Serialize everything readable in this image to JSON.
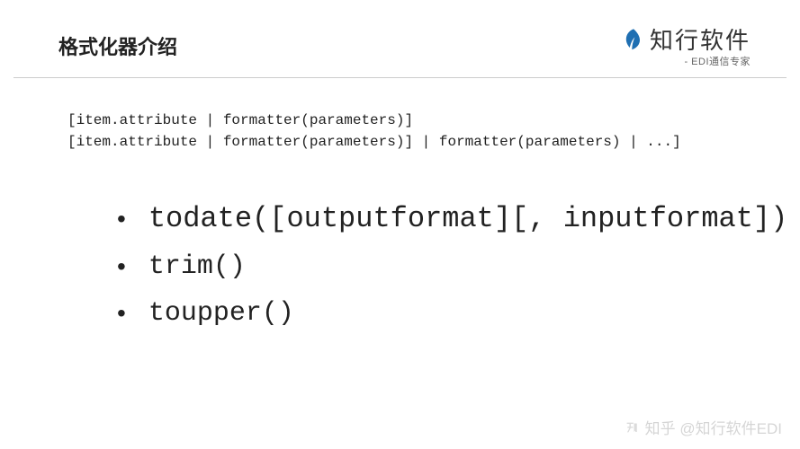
{
  "header": {
    "title": "格式化器介绍",
    "logo_text": "知行软件",
    "logo_subtitle": "- EDI通信专家"
  },
  "code": {
    "line1": "[item.attribute | formatter(parameters)]",
    "line2": "[item.attribute | formatter(parameters)] | formatter(parameters) | ...]"
  },
  "bullets": [
    {
      "text": "todate([outputformat][, inputformat])"
    },
    {
      "text": "trim()"
    },
    {
      "text": "toupper()"
    }
  ],
  "watermark": {
    "brand": "知乎",
    "handle": "@知行软件EDI"
  }
}
